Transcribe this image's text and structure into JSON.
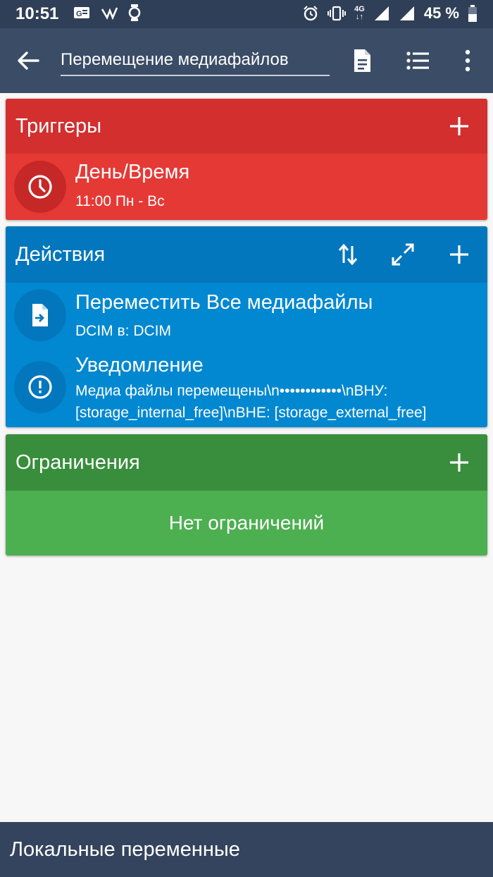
{
  "status_bar": {
    "time": "10:51",
    "battery_percent": "45 %",
    "network": "4G"
  },
  "app_bar": {
    "title_value": "Перемещение медиафайлов",
    "icons": [
      "back-arrow-icon",
      "document-icon",
      "list-icon",
      "more-vert-icon"
    ]
  },
  "triggers": {
    "title": "Триггеры",
    "header_color": "#d32f2f",
    "body_color": "#e53935",
    "items": [
      {
        "title": "День/Время",
        "subtitle": "11:00 Пн - Вс",
        "icon": "clock-icon"
      }
    ]
  },
  "actions": {
    "title": "Действия",
    "header_color": "#0277bd",
    "body_color": "#0288d1",
    "items": [
      {
        "title": "Переместить Все медиафайлы",
        "subtitle": "DCIM в: DCIM",
        "icon": "file-move-icon"
      },
      {
        "title": "Уведомление",
        "subtitle": "Медиа файлы перемещены\\n••••••••••••\\nВНУ: [storage_internal_free]\\nВНЕ: [storage_external_free]",
        "icon": "alert-icon"
      }
    ]
  },
  "constraints": {
    "title": "Ограничения",
    "header_color": "#388e3c",
    "body_color": "#4caf50",
    "empty_text": "Нет ограничений"
  },
  "bottom_bar": {
    "label": "Локальные переменные"
  }
}
